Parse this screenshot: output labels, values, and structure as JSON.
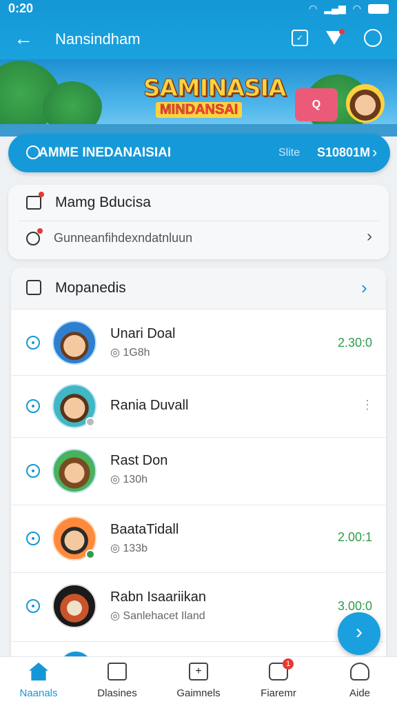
{
  "status_bar": {
    "time": "0:20",
    "icons": [
      "wifi-icon",
      "signal-icon",
      "wifi-icon",
      "battery-icon"
    ]
  },
  "app_bar": {
    "title": "Nansindham",
    "actions": [
      "edit-icon",
      "notification-icon",
      "settings-icon"
    ]
  },
  "banner": {
    "logo_line1": "SAMINASIA",
    "logo_line2": "MINDANSAI",
    "badge_text": "Q"
  },
  "promo_pill": {
    "title": "AMME INEDANAISIAI",
    "subtitle": "Slite",
    "value": "S10801M"
  },
  "card1": {
    "title": "Mamg Bducisa",
    "subtitle": "Gunneanfihdexndatnluun"
  },
  "list_section": {
    "title": "Mopanedis",
    "rows": [
      {
        "name": "Unari Doal",
        "meta": "1G8h",
        "score": "2.30:0"
      },
      {
        "name": "Rania Duvall",
        "meta": "",
        "score": ""
      },
      {
        "name": "Rast Don",
        "meta": "130h",
        "score": ""
      },
      {
        "name": "BaataTidall",
        "meta": "133b",
        "score": "2.00:1"
      },
      {
        "name": "Rabn Isaariikan",
        "meta": "Sanlehacet Iland",
        "score": "3.00:0"
      }
    ]
  },
  "bottom_nav": {
    "items": [
      {
        "label": "Naanals",
        "icon": "home-icon"
      },
      {
        "label": "Dlasines",
        "icon": "store-icon"
      },
      {
        "label": "Gaimnels",
        "icon": "games-icon"
      },
      {
        "label": "Fiaremr",
        "icon": "chat-icon",
        "badge": "1"
      },
      {
        "label": "Aide",
        "icon": "profile-icon"
      }
    ]
  },
  "colors": {
    "primary": "#1597d6",
    "score_green": "#2e9d4a",
    "badge_red": "#e53935"
  }
}
